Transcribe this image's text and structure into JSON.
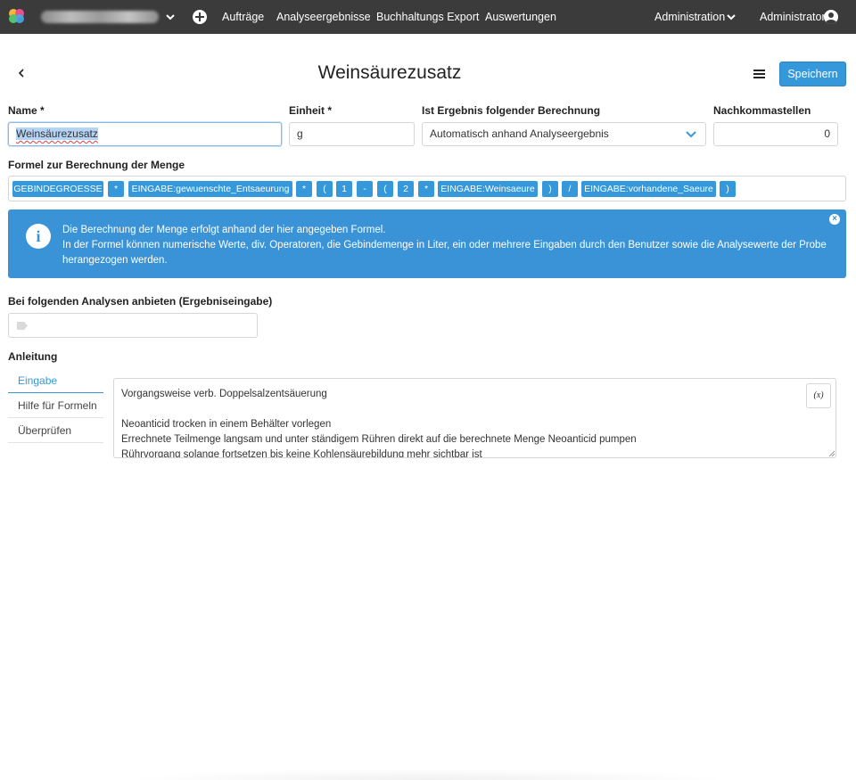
{
  "navbar": {
    "org_name": "Weinkellerei",
    "links": [
      "Aufträge",
      "Analyseergebnisse",
      "Buchhaltungs Export",
      "Auswertungen"
    ],
    "admin_menu": "Administration",
    "user": "Administrator",
    "background": "#3b3b3b"
  },
  "header": {
    "title": "Weinsäurezusatz",
    "save_label": "Speichern",
    "accent": "#3498db"
  },
  "form": {
    "name_label": "Name *",
    "name_value": "Weinsäurezusatz",
    "unit_label": "Einheit *",
    "unit_value": "g",
    "calc_label": "Ist Ergebnis folgender Berechnung",
    "calc_value": "Automatisch anhand Analyseergebnis",
    "decimals_label": "Nachkommastellen",
    "decimals_value": "0"
  },
  "formula": {
    "label": "Formel zur Berechnung der Menge",
    "tokens": [
      "GEBINDEGROESSE",
      "*",
      "EINGABE:gewuenschte_Entsaeurung",
      "*",
      "(",
      "1",
      "-",
      "(",
      "2",
      "*",
      "EINGABE:Weinsaeure",
      ")",
      "/",
      "EINGABE:vorhandene_Saeure",
      ")"
    ]
  },
  "info": {
    "line1": "Die Berechnung der Menge erfolgt anhand der hier angegeben Formel.",
    "line2": "In der Formel können numerische Werte, div. Operatoren, die Gebindemenge in Liter, ein oder mehrere Eingaben durch den Benutzer sowie die Analysewerte der Probe herangezogen werden."
  },
  "analyses": {
    "label": "Bei folgenden Analysen anbieten (Ergebniseingabe)"
  },
  "instructions": {
    "label": "Anleitung",
    "tabs": [
      "Eingabe",
      "Hilfe für Formeln",
      "Überprüfen"
    ],
    "active_tab": "Eingabe",
    "lines": [
      "Vorgangsweise verb. Doppelsalzentsäuerung",
      "",
      "Neoanticid trocken in einem Behälter vorlegen",
      "Errechnete Teilmenge langsam und unter ständigem Rühren direkt auf die berechnete Menge Neoanticid pumpen",
      "Rührvorgang solange fortsetzen bis keine Kohlensäurebildung mehr sichtbar ist"
    ],
    "variable_button": "(x)"
  }
}
